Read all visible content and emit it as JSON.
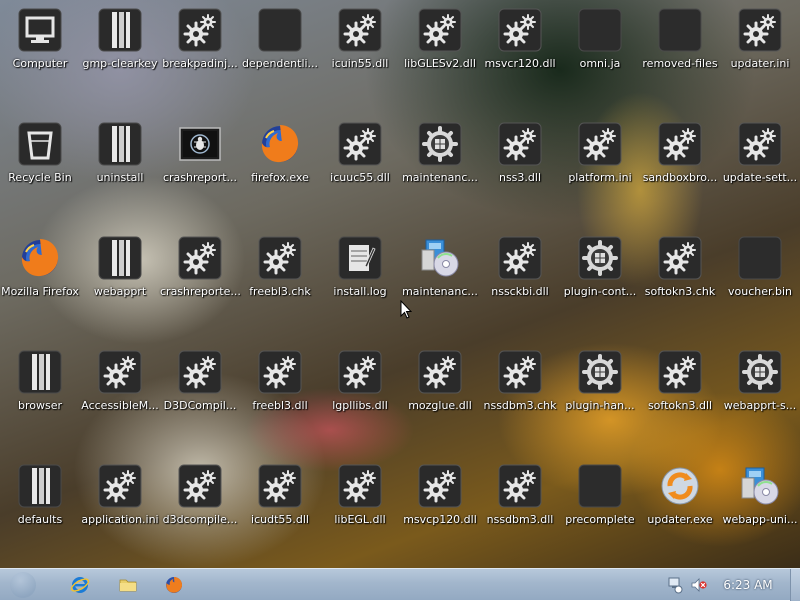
{
  "desktop": {
    "icons": [
      {
        "label": "Computer",
        "icon": "computer-icon"
      },
      {
        "label": "gmp-clearkey",
        "icon": "folder-icon"
      },
      {
        "label": "breakpadinj...",
        "icon": "settings-file-icon"
      },
      {
        "label": "dependentli...",
        "icon": "blank-file-icon"
      },
      {
        "label": "icuin55.dll",
        "icon": "settings-file-icon"
      },
      {
        "label": "libGLESv2.dll",
        "icon": "settings-file-icon"
      },
      {
        "label": "msvcr120.dll",
        "icon": "settings-file-icon"
      },
      {
        "label": "omni.ja",
        "icon": "blank-file-icon"
      },
      {
        "label": "removed-files",
        "icon": "blank-file-icon"
      },
      {
        "label": "updater.ini",
        "icon": "settings-file-icon"
      },
      {
        "label": "Recycle Bin",
        "icon": "recycle-bin-icon"
      },
      {
        "label": "uninstall",
        "icon": "folder-icon"
      },
      {
        "label": "crashreport...",
        "icon": "bug-app-icon"
      },
      {
        "label": "firefox.exe",
        "icon": "firefox-icon"
      },
      {
        "label": "icuuc55.dll",
        "icon": "settings-file-icon"
      },
      {
        "label": "maintenanc...",
        "icon": "windows-gear-icon"
      },
      {
        "label": "nss3.dll",
        "icon": "settings-file-icon"
      },
      {
        "label": "platform.ini",
        "icon": "settings-file-icon"
      },
      {
        "label": "sandboxbro...",
        "icon": "settings-file-icon"
      },
      {
        "label": "update-sett...",
        "icon": "settings-file-icon"
      },
      {
        "label": "Mozilla Firefox",
        "icon": "firefox-icon"
      },
      {
        "label": "webapprt",
        "icon": "folder-icon"
      },
      {
        "label": "crashreporte...",
        "icon": "settings-file-icon"
      },
      {
        "label": "freebl3.chk",
        "icon": "settings-file-icon"
      },
      {
        "label": "install.log",
        "icon": "text-file-icon"
      },
      {
        "label": "maintenanc...",
        "icon": "installer-icon"
      },
      {
        "label": "nssckbi.dll",
        "icon": "settings-file-icon"
      },
      {
        "label": "plugin-cont...",
        "icon": "windows-gear-icon"
      },
      {
        "label": "softokn3.chk",
        "icon": "settings-file-icon"
      },
      {
        "label": "voucher.bin",
        "icon": "blank-file-icon"
      },
      {
        "label": "browser",
        "icon": "folder-icon"
      },
      {
        "label": "AccessibleM...",
        "icon": "settings-file-icon"
      },
      {
        "label": "D3DCompil...",
        "icon": "settings-file-icon"
      },
      {
        "label": "freebl3.dll",
        "icon": "settings-file-icon"
      },
      {
        "label": "lgpllibs.dll",
        "icon": "settings-file-icon"
      },
      {
        "label": "mozglue.dll",
        "icon": "settings-file-icon"
      },
      {
        "label": "nssdbm3.chk",
        "icon": "settings-file-icon"
      },
      {
        "label": "plugin-han...",
        "icon": "windows-gear-icon"
      },
      {
        "label": "softokn3.dll",
        "icon": "settings-file-icon"
      },
      {
        "label": "webapprt-s...",
        "icon": "windows-gear-icon"
      },
      {
        "label": "defaults",
        "icon": "folder-icon"
      },
      {
        "label": "application.ini",
        "icon": "settings-file-icon"
      },
      {
        "label": "d3dcompile...",
        "icon": "settings-file-icon"
      },
      {
        "label": "icudt55.dll",
        "icon": "settings-file-icon"
      },
      {
        "label": "libEGL.dll",
        "icon": "settings-file-icon"
      },
      {
        "label": "msvcp120.dll",
        "icon": "settings-file-icon"
      },
      {
        "label": "nssdbm3.dll",
        "icon": "settings-file-icon"
      },
      {
        "label": "precomplete",
        "icon": "blank-file-icon"
      },
      {
        "label": "updater.exe",
        "icon": "updater-icon"
      },
      {
        "label": "webapp-uni...",
        "icon": "installer-icon"
      }
    ]
  },
  "taskbar": {
    "pinned": [
      {
        "name": "internet-explorer-icon"
      },
      {
        "name": "folder-explorer-icon"
      },
      {
        "name": "firefox-taskbar-icon"
      }
    ],
    "tray": [
      {
        "name": "network-icon"
      },
      {
        "name": "volume-muted-icon"
      }
    ],
    "clock": "6:23 AM"
  }
}
